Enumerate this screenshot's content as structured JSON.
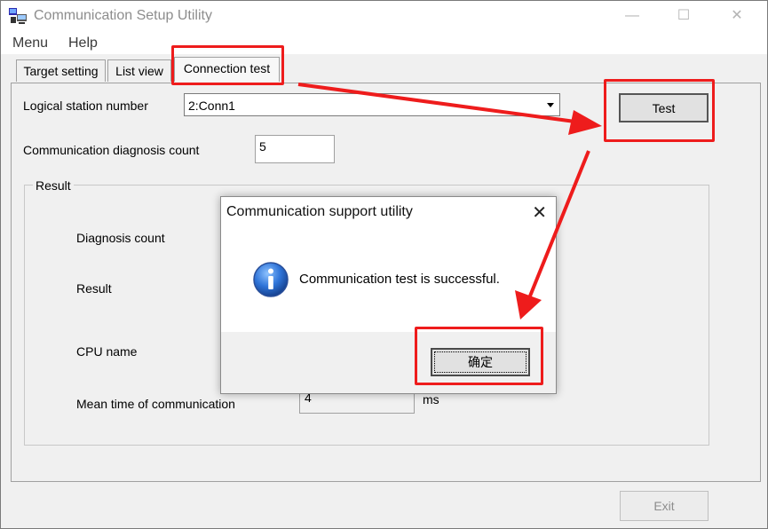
{
  "window": {
    "title": "Communication Setup Utility",
    "controls": {
      "minimize": "—",
      "maximize": "☐",
      "close": "✕"
    }
  },
  "menubar": {
    "items": [
      "Menu",
      "Help"
    ]
  },
  "tabs": [
    {
      "label": "Target setting",
      "active": false
    },
    {
      "label": "List view",
      "active": false
    },
    {
      "label": "Connection test",
      "active": true
    }
  ],
  "form": {
    "logical_station_label": "Logical station number",
    "logical_station_value": "2:Conn1",
    "diag_count_label": "Communication diagnosis count",
    "diag_count_value": "5",
    "test_button": "Test"
  },
  "result": {
    "group_label": "Result",
    "diagnosis_count_label": "Diagnosis count",
    "result_label": "Result",
    "cpu_name_label": "CPU name",
    "mean_time_label": "Mean time of communication",
    "mean_time_value": "4",
    "mean_time_unit": "ms"
  },
  "exit_button": "Exit",
  "dialog": {
    "title": "Communication support utility",
    "close_glyph": "✕",
    "icon": "info-icon",
    "message": "Communication test is successful.",
    "ok_button": "确定"
  },
  "colors": {
    "annotation_red": "#ee1c1c",
    "info_blue": "#1f5fbf",
    "disabled_text": "#8d8d8d"
  }
}
